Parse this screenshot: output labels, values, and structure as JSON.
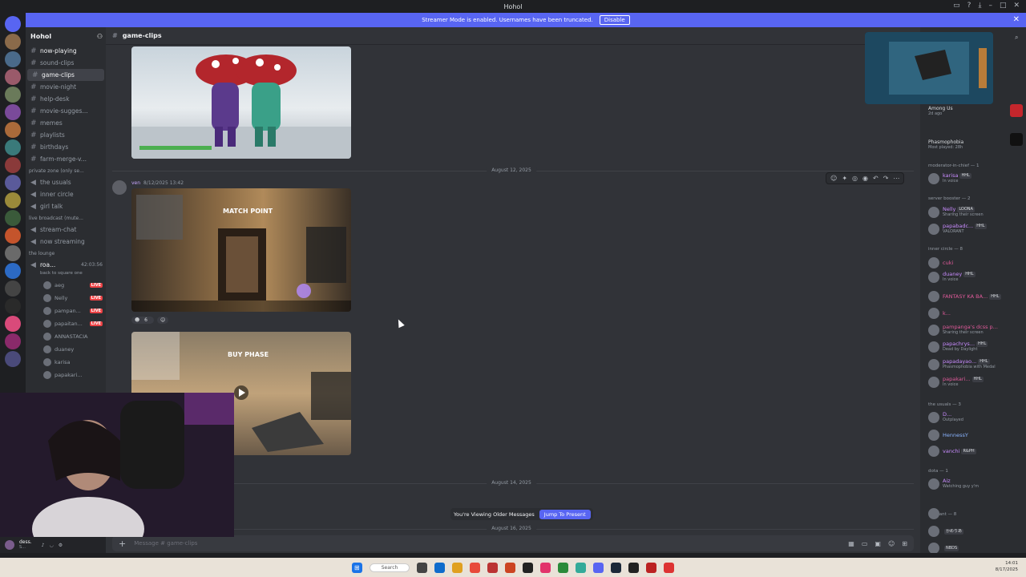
{
  "window": {
    "title": "Hohol"
  },
  "banner": {
    "text": "Streamer Mode is enabled. Usernames have been truncated.",
    "button": "Disable"
  },
  "server": {
    "name": "Hohol"
  },
  "channels": [
    {
      "name": "now-playing",
      "bright": true
    },
    {
      "name": "sound-clips"
    },
    {
      "name": "game-clips",
      "active": true
    },
    {
      "name": "movie-night"
    },
    {
      "name": "help-desk"
    },
    {
      "name": "movie-sugges..."
    },
    {
      "name": "memes"
    },
    {
      "name": "playlists"
    },
    {
      "name": "birthdays"
    },
    {
      "name": "farm-merge-v..."
    }
  ],
  "private_category": "private zone (only se...",
  "private_channels": [
    "the usuals",
    "inner circle",
    "girl talk"
  ],
  "live_category": "live broadcast (mute...",
  "live_channels": [
    "stream-chat",
    "now streaming"
  ],
  "lounge_category": "the lounge",
  "voice_channel": {
    "name": "roa...",
    "time": "42:03:56",
    "status": "back to square one"
  },
  "voice_users": [
    {
      "name": "aeg",
      "live": "LIVE"
    },
    {
      "name": "Nelly",
      "live": "LIVE"
    },
    {
      "name": "pampan...",
      "live": "LIVE"
    },
    {
      "name": "papaitan...",
      "live": "LIVE"
    },
    {
      "name": "ANNASTACIA",
      "live": ""
    },
    {
      "name": "duaney",
      "live": ""
    },
    {
      "name": "karisa",
      "live": ""
    },
    {
      "name": "papakari...",
      "live": ""
    }
  ],
  "channel_header": {
    "name": "game-clips"
  },
  "dates": [
    "August 12, 2025",
    "August 14, 2025",
    "August 16, 2025"
  ],
  "message": {
    "author": "ven",
    "timestamp": "8/12/2025 13:42"
  },
  "reactions": {
    "count": "6"
  },
  "clip_texts": {
    "match_point": "MATCH POINT",
    "buy_phase": "BUY PHASE"
  },
  "older_messages": {
    "text": "You're Viewing Older Messages",
    "button": "Jump To Present"
  },
  "composer": {
    "placeholder": "Message #  game-clips"
  },
  "members": {
    "activities": [
      {
        "title": "Among Us",
        "time": "2d ago"
      },
      {
        "title": "Phasmophobia",
        "time": "Most played: 28h"
      }
    ],
    "groups": [
      {
        "label": "moderator-in-chief — 1"
      },
      {
        "label": "server booster — 2"
      },
      {
        "label": "inner circle — 8"
      },
      {
        "label": "the usuals — 3"
      },
      {
        "label": "dota — 1"
      },
      {
        "label": "valorant — 8"
      }
    ],
    "list": [
      {
        "name": "karisa",
        "tag": "HHL",
        "status": "In voice"
      },
      {
        "name": "Nelly",
        "tag": "LOONA",
        "status": "Sharing their screen"
      },
      {
        "name": "papabadc...",
        "tag": "HHL",
        "status": "VALORANT"
      },
      {
        "name": "cuki",
        "tag": "",
        "status": ""
      },
      {
        "name": "duaney",
        "tag": "HHL",
        "status": "In voice"
      },
      {
        "name": "FANTASY KA BA...",
        "tag": "HHL",
        "status": ""
      },
      {
        "name": "k...",
        "tag": "",
        "status": ""
      },
      {
        "name": "pampanga's dcss p...",
        "tag": "",
        "status": "Sharing their screen"
      },
      {
        "name": "papachrys...",
        "tag": "HHL",
        "status": "Dead by Daylight"
      },
      {
        "name": "papadayao...",
        "tag": "HHL",
        "status": "Phasmophobia with Medal"
      },
      {
        "name": "papakari...",
        "tag": "HHL",
        "status": "In voice"
      },
      {
        "name": "D...",
        "tag": "",
        "status": "Outplayed"
      },
      {
        "name": "HennessY",
        "tag": "",
        "status": ""
      },
      {
        "name": "vanchi",
        "tag": "R&PH",
        "status": ""
      },
      {
        "name": "Aiz",
        "tag": "",
        "status": "Watching guy y'm"
      },
      {
        "name": "",
        "tag": "",
        "status": ""
      },
      {
        "name": "",
        "tag": "かめりあ",
        "status": ""
      },
      {
        "name": "",
        "tag": "NBDS",
        "status": ""
      }
    ]
  },
  "user_panel": {
    "name": "dess.",
    "status": "S..."
  },
  "taskbar": {
    "search": "Search",
    "time": "14:01",
    "date": "8/17/2025"
  },
  "colors": {
    "accent": "#5865f2",
    "live": "#ed4245",
    "name": "#c98cff"
  }
}
